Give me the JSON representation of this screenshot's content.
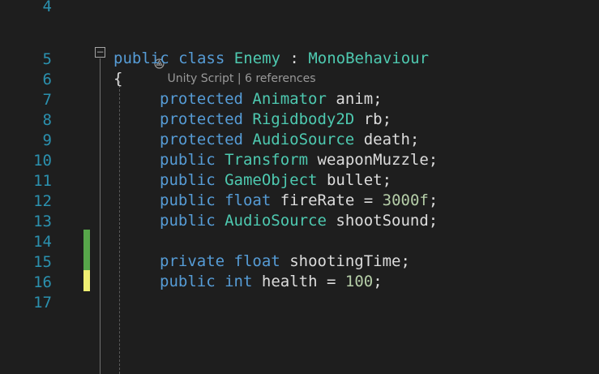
{
  "colors": {
    "background": "#1e1e1e",
    "line_number": "#2b91af",
    "keyword": "#569cd6",
    "type": "#4ec9b0",
    "identifier": "#dcdcdc",
    "number": "#b5cea8",
    "codelens": "#999999",
    "saved_change": "#57a64a",
    "unsaved_change": "#efef72"
  },
  "codelens": {
    "icon": "unity-logo-icon",
    "label": "Unity Script",
    "separator": "|",
    "references": "6 references"
  },
  "fold_glyph": "−",
  "line_numbers": [
    "4",
    "5",
    "6",
    "7",
    "8",
    "9",
    "10",
    "11",
    "12",
    "13",
    "14",
    "15",
    "16",
    "17"
  ],
  "code": {
    "l5": {
      "kw1": "public",
      "kw2": "class",
      "name": "Enemy",
      "colon": ":",
      "base": "MonoBehaviour"
    },
    "l6": {
      "brace": "{"
    },
    "l7": {
      "kw": "protected",
      "type": "Animator",
      "name": "anim;"
    },
    "l8": {
      "kw": "protected",
      "type": "Rigidbody2D",
      "name": "rb;"
    },
    "l9": {
      "kw": "protected",
      "type": "AudioSource",
      "name": "death;"
    },
    "l10": {
      "kw": "public",
      "type": "Transform",
      "name": "weaponMuzzle;"
    },
    "l11": {
      "kw": "public",
      "type": "GameObject",
      "name": "bullet;"
    },
    "l12": {
      "kw1": "public",
      "kw2": "float",
      "name": "fireRate",
      "eq": "=",
      "value": "3000f",
      "end": ";"
    },
    "l13": {
      "kw": "public",
      "type": "AudioSource",
      "name": "shootSound;"
    },
    "l15": {
      "kw1": "private",
      "kw2": "float",
      "name": "shootingTime;"
    },
    "l16": {
      "kw1": "public",
      "kw2": "int",
      "name": "health",
      "eq": "=",
      "value": "100",
      "end": ";"
    }
  }
}
